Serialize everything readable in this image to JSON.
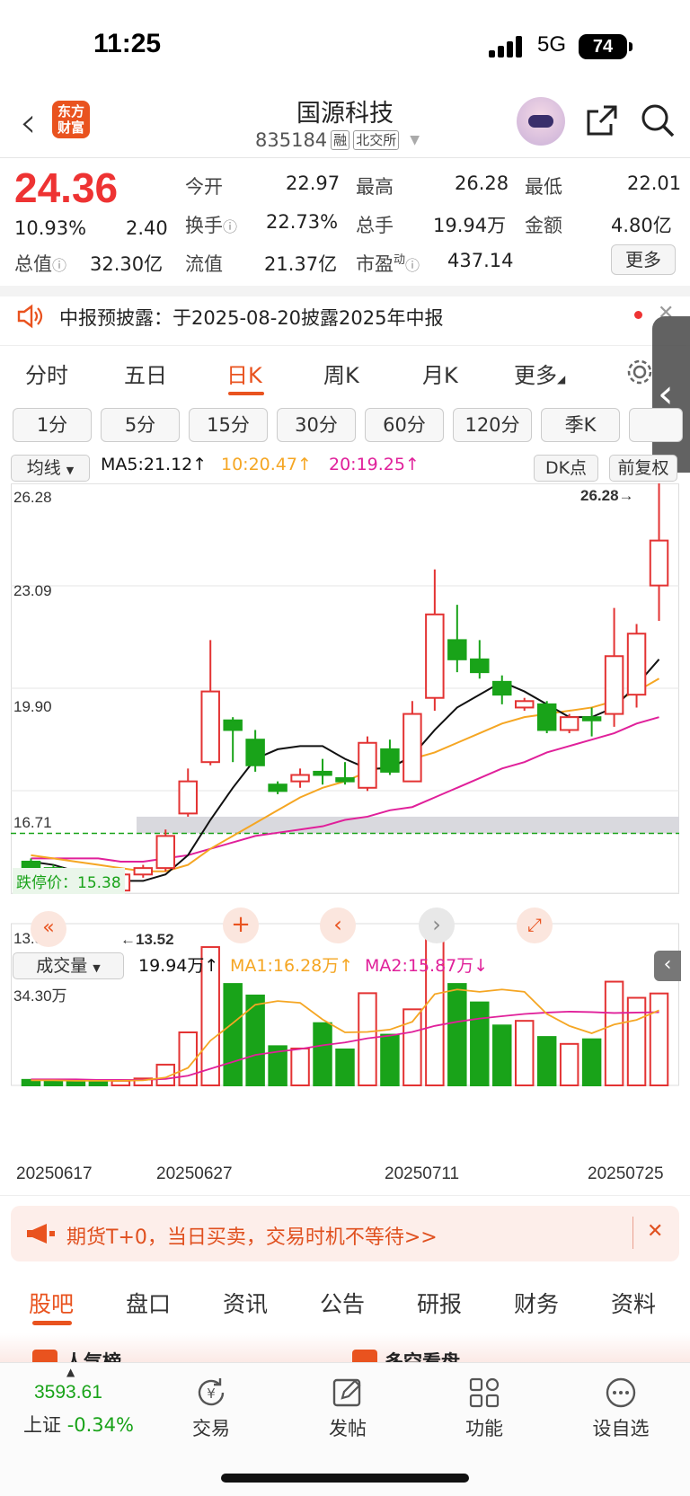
{
  "status": {
    "time": "11:25",
    "network": "5G",
    "battery": "74"
  },
  "header": {
    "logo_line1": "东方",
    "logo_line2": "财富",
    "title": "国源科技",
    "code": "835184",
    "tag1": "融",
    "tag2": "北交所"
  },
  "quote": {
    "price": "24.36",
    "pct": "10.93%",
    "change": "2.40",
    "open_label": "今开",
    "open": "22.97",
    "high_label": "最高",
    "high": "26.28",
    "low_label": "最低",
    "low": "22.01",
    "turnover_label": "换手",
    "turnover": "22.73%",
    "volume_label": "总手",
    "volume": "19.94万",
    "amount_label": "金额",
    "amount": "4.80亿",
    "mktcap_label": "总值",
    "mktcap": "32.30亿",
    "float_label": "流值",
    "float": "21.37亿",
    "pe_label": "市盈",
    "pe_sup": "动",
    "pe": "437.14",
    "more": "更多"
  },
  "notice": {
    "text": "中报预披露：于2025-08-20披露2025年中报"
  },
  "tabs": [
    "分时",
    "五日",
    "日K",
    "周K",
    "月K",
    "更多"
  ],
  "periods": [
    "1分",
    "5分",
    "15分",
    "30分",
    "60分",
    "120分",
    "季K"
  ],
  "indicators": {
    "ma_select": "均线",
    "ma5": "MA5:21.12↑",
    "ma10": "10:20.47↑",
    "ma20": "20:19.25↑",
    "dk": "DK点",
    "adjust": "前复权",
    "limit_down": "跌停价：15.38",
    "max_marker": "26.28→",
    "min_marker": "←13.52"
  },
  "volume_bar": {
    "select": "成交量",
    "vol": "19.94万↑",
    "ma1": "MA1:16.28万↑",
    "ma2": "MA2:15.87万↓",
    "max_label": "34.30万"
  },
  "colors": {
    "up": "#e33333",
    "down": "#19a319",
    "ma5": "#111111",
    "ma10": "#f5a623",
    "ma20": "#e0209a",
    "accent": "#e9531f"
  },
  "chart_data": {
    "type": "candlestick",
    "y_ticks": [
      "26.28",
      "23.09",
      "19.90",
      "16.71",
      "13.52"
    ],
    "ylim": [
      13.52,
      26.28
    ],
    "date_labels": [
      "20250617",
      "20250627",
      "20250711",
      "20250725"
    ],
    "candles": [
      {
        "o": 14.5,
        "c": 14.3,
        "h": 14.6,
        "l": 14.1
      },
      {
        "o": 14.3,
        "c": 14.2,
        "h": 14.4,
        "l": 13.9
      },
      {
        "o": 14.2,
        "c": 13.8,
        "h": 14.3,
        "l": 13.7
      },
      {
        "o": 13.8,
        "c": 13.7,
        "h": 13.9,
        "l": 13.6
      },
      {
        "o": 13.6,
        "c": 14.1,
        "h": 14.2,
        "l": 13.52
      },
      {
        "o": 14.1,
        "c": 14.3,
        "h": 14.4,
        "l": 14.0
      },
      {
        "o": 14.3,
        "c": 15.3,
        "h": 15.5,
        "l": 14.2
      },
      {
        "o": 16.0,
        "c": 17.0,
        "h": 17.4,
        "l": 15.9
      },
      {
        "o": 17.6,
        "c": 19.8,
        "h": 21.4,
        "l": 17.5
      },
      {
        "o": 18.9,
        "c": 18.6,
        "h": 19.0,
        "l": 17.6
      },
      {
        "o": 18.3,
        "c": 17.5,
        "h": 18.6,
        "l": 17.3
      },
      {
        "o": 16.9,
        "c": 16.7,
        "h": 17.0,
        "l": 16.6
      },
      {
        "o": 17.0,
        "c": 17.2,
        "h": 17.4,
        "l": 16.8
      },
      {
        "o": 17.3,
        "c": 17.2,
        "h": 17.7,
        "l": 16.9
      },
      {
        "o": 17.1,
        "c": 17.0,
        "h": 17.6,
        "l": 16.9
      },
      {
        "o": 16.8,
        "c": 18.2,
        "h": 18.4,
        "l": 16.7
      },
      {
        "o": 18.0,
        "c": 17.3,
        "h": 18.3,
        "l": 17.2
      },
      {
        "o": 17.0,
        "c": 19.1,
        "h": 19.5,
        "l": 17.0
      },
      {
        "o": 19.6,
        "c": 22.2,
        "h": 23.6,
        "l": 19.2
      },
      {
        "o": 21.4,
        "c": 20.8,
        "h": 22.5,
        "l": 20.4
      },
      {
        "o": 20.8,
        "c": 20.4,
        "h": 21.4,
        "l": 20.2
      },
      {
        "o": 20.1,
        "c": 19.7,
        "h": 20.3,
        "l": 19.4
      },
      {
        "o": 19.3,
        "c": 19.5,
        "h": 19.6,
        "l": 19.2
      },
      {
        "o": 19.4,
        "c": 18.6,
        "h": 19.5,
        "l": 18.5
      },
      {
        "o": 18.6,
        "c": 19.0,
        "h": 19.1,
        "l": 18.5
      },
      {
        "o": 19.0,
        "c": 18.9,
        "h": 19.3,
        "l": 18.4
      },
      {
        "o": 19.1,
        "c": 20.9,
        "h": 22.4,
        "l": 18.7
      },
      {
        "o": 19.7,
        "c": 21.6,
        "h": 21.9,
        "l": 19.3
      },
      {
        "o": 23.1,
        "c": 24.5,
        "h": 26.28,
        "l": 22.0
      }
    ],
    "ma5": [
      14.5,
      14.4,
      14.2,
      14.0,
      13.9,
      13.9,
      14.1,
      14.7,
      15.8,
      16.8,
      17.7,
      18.0,
      18.1,
      18.1,
      17.7,
      17.4,
      17.4,
      17.8,
      18.6,
      19.3,
      19.7,
      20.1,
      19.8,
      19.4,
      19.0,
      19.0,
      19.3,
      20.0,
      20.8
    ],
    "ma10": [
      14.7,
      14.6,
      14.5,
      14.4,
      14.3,
      14.2,
      14.2,
      14.4,
      14.9,
      15.3,
      15.7,
      16.1,
      16.5,
      16.8,
      17.0,
      17.3,
      17.5,
      17.7,
      17.9,
      18.2,
      18.5,
      18.8,
      19.0,
      19.1,
      19.2,
      19.3,
      19.5,
      19.8,
      20.2
    ],
    "ma20": [
      14.6,
      14.6,
      14.6,
      14.6,
      14.5,
      14.5,
      14.6,
      14.7,
      14.9,
      15.1,
      15.3,
      15.4,
      15.5,
      15.6,
      15.8,
      15.9,
      16.1,
      16.2,
      16.5,
      16.8,
      17.1,
      17.4,
      17.6,
      17.9,
      18.1,
      18.3,
      18.5,
      18.8,
      19.0
    ],
    "volumes": [
      1.2,
      1.1,
      1.0,
      0.9,
      1.0,
      1.5,
      4.5,
      11.5,
      30.0,
      22.0,
      19.5,
      8.5,
      8.0,
      13.5,
      7.8,
      20.0,
      11.0,
      16.5,
      34.3,
      22.0,
      18.0,
      13.0,
      14.0,
      10.5,
      9.0,
      10.0,
      22.5,
      19.0,
      19.94
    ],
    "vol_ma1": [
      1.1,
      1.1,
      1.0,
      1.0,
      1.0,
      1.1,
      1.7,
      3.8,
      9.7,
      13.5,
      17.5,
      18.3,
      17.9,
      14.3,
      11.5,
      11.6,
      12.1,
      13.8,
      19.8,
      20.8,
      20.3,
      20.8,
      20.3,
      15.5,
      12.9,
      11.3,
      13.2,
      14.2,
      16.28
    ],
    "vol_ma2": [
      1.3,
      1.3,
      1.3,
      1.2,
      1.2,
      1.2,
      1.4,
      2.1,
      3.6,
      5.1,
      6.6,
      7.3,
      7.9,
      8.7,
      9.3,
      10.2,
      10.8,
      11.6,
      12.9,
      13.8,
      14.5,
      15.0,
      15.5,
      15.8,
      16.0,
      15.9,
      15.7,
      15.8,
      15.87
    ]
  },
  "promo": {
    "text": "期货T+0，当日买卖，交易时机不等待>>"
  },
  "bottom_tabs": [
    "股吧",
    "盘口",
    "资讯",
    "公告",
    "研报",
    "财务",
    "资料"
  ],
  "peek": {
    "left": "人气榜",
    "right": "多空看盘"
  },
  "nav": {
    "index_value": "3593.61",
    "index_name": "上证",
    "index_change": "-0.34%",
    "trade": "交易",
    "post": "发帖",
    "func": "功能",
    "watch": "设自选"
  }
}
